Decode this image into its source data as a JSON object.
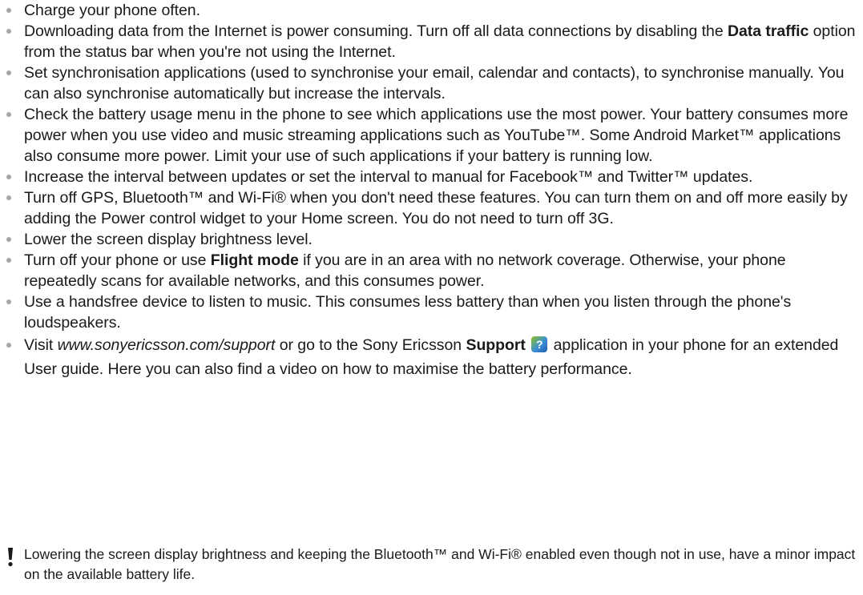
{
  "tips": {
    "t1": "Charge your phone often.",
    "t2_a": "Downloading data from the Internet is power consuming. Turn off all data connections by disabling the ",
    "t2_bold": "Data traffic",
    "t2_b": " option from the status bar when you're not using the Internet.",
    "t3": "Set synchronisation applications (used to synchronise your email, calendar and contacts), to synchronise manually. You can also synchronise automatically but increase the intervals.",
    "t4": "Check the battery usage menu in the phone to see which applications use the most power. Your battery consumes more power when you use video and music streaming applications such as YouTube™. Some Android Market™ applications also consume more power. Limit your use of such applications if your battery is running low.",
    "t5": "Increase the interval between updates or set the interval to manual for Facebook™ and Twitter™ updates.",
    "t6": "Turn off GPS, Bluetooth™ and Wi-Fi® when you don't need these features. You can turn them on and off more easily by adding the Power control widget to your Home screen. You do not need to turn off 3G.",
    "t7": "Lower the screen display brightness level.",
    "t8_a": "Turn off your phone or use ",
    "t8_bold": "Flight mode",
    "t8_b": " if you are in an area with no network coverage. Otherwise, your phone repeatedly scans for available networks, and this consumes power.",
    "t9": "Use a handsfree device to listen to music. This consumes less battery than when you listen through the phone's loudspeakers.",
    "t10_a": "Visit ",
    "t10_link": "www.sonyericsson.com/support",
    "t10_b": " or go to the Sony Ericsson ",
    "t10_bold": "Support",
    "t10_c": " application in your phone for an extended User guide. Here you can also find a video on how to maximise the battery performance."
  },
  "note": {
    "text": "Lowering the screen display brightness and keeping the Bluetooth™ and Wi-Fi® enabled even though not in use, have a minor impact on the available battery life.",
    "icon": "exclamation-icon"
  },
  "icons": {
    "support": "support-question-icon",
    "support_glyph": "?"
  },
  "colors": {
    "bullet": "#a6a6a6",
    "text": "#1a1a1a",
    "support_icon": "#3b8fd6"
  }
}
